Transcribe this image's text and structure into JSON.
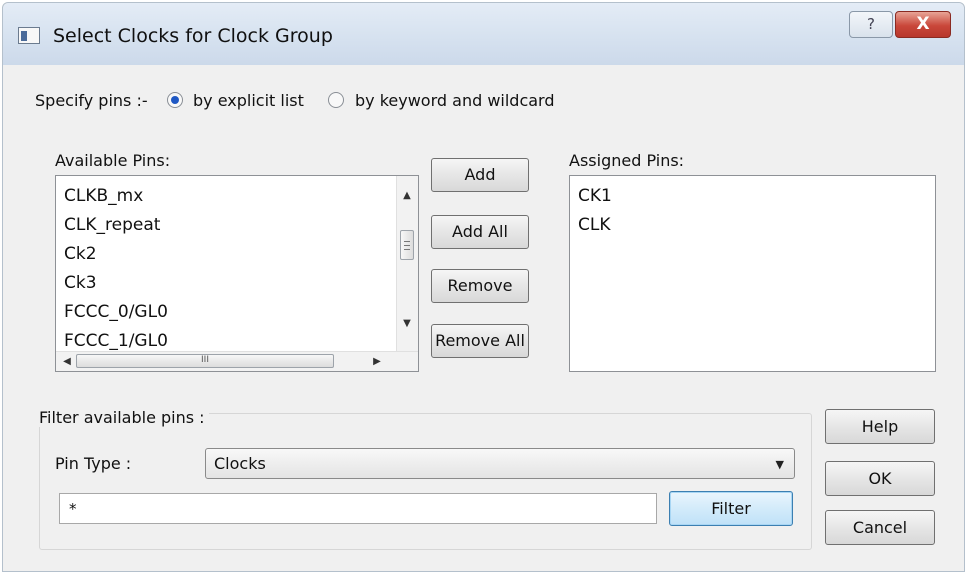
{
  "window": {
    "title": "Select Clocks for Clock Group",
    "help_glyph": "?",
    "close_glyph": "X"
  },
  "specify": {
    "label": "Specify pins :-",
    "option_explicit": "by explicit list",
    "option_keyword": "by keyword and wildcard",
    "selected": "by explicit list"
  },
  "available": {
    "label": "Available Pins:",
    "items": [
      "CLKB_mx",
      "CLK_repeat",
      "Ck2",
      "Ck3",
      "FCCC_0/GL0",
      "FCCC_1/GL0"
    ],
    "hscroll_grip": "III"
  },
  "buttons": {
    "add": "Add",
    "add_all": "Add All",
    "remove": "Remove",
    "remove_all": "Remove All"
  },
  "assigned": {
    "label": "Assigned Pins:",
    "items": [
      "CK1",
      "CLK"
    ]
  },
  "filter": {
    "group_label": "Filter available pins :",
    "pin_type_label": "Pin Type :",
    "pin_type_value": "Clocks",
    "text_value": "*",
    "filter_button": "Filter"
  },
  "dialog_buttons": {
    "help": "Help",
    "ok": "OK",
    "cancel": "Cancel"
  }
}
